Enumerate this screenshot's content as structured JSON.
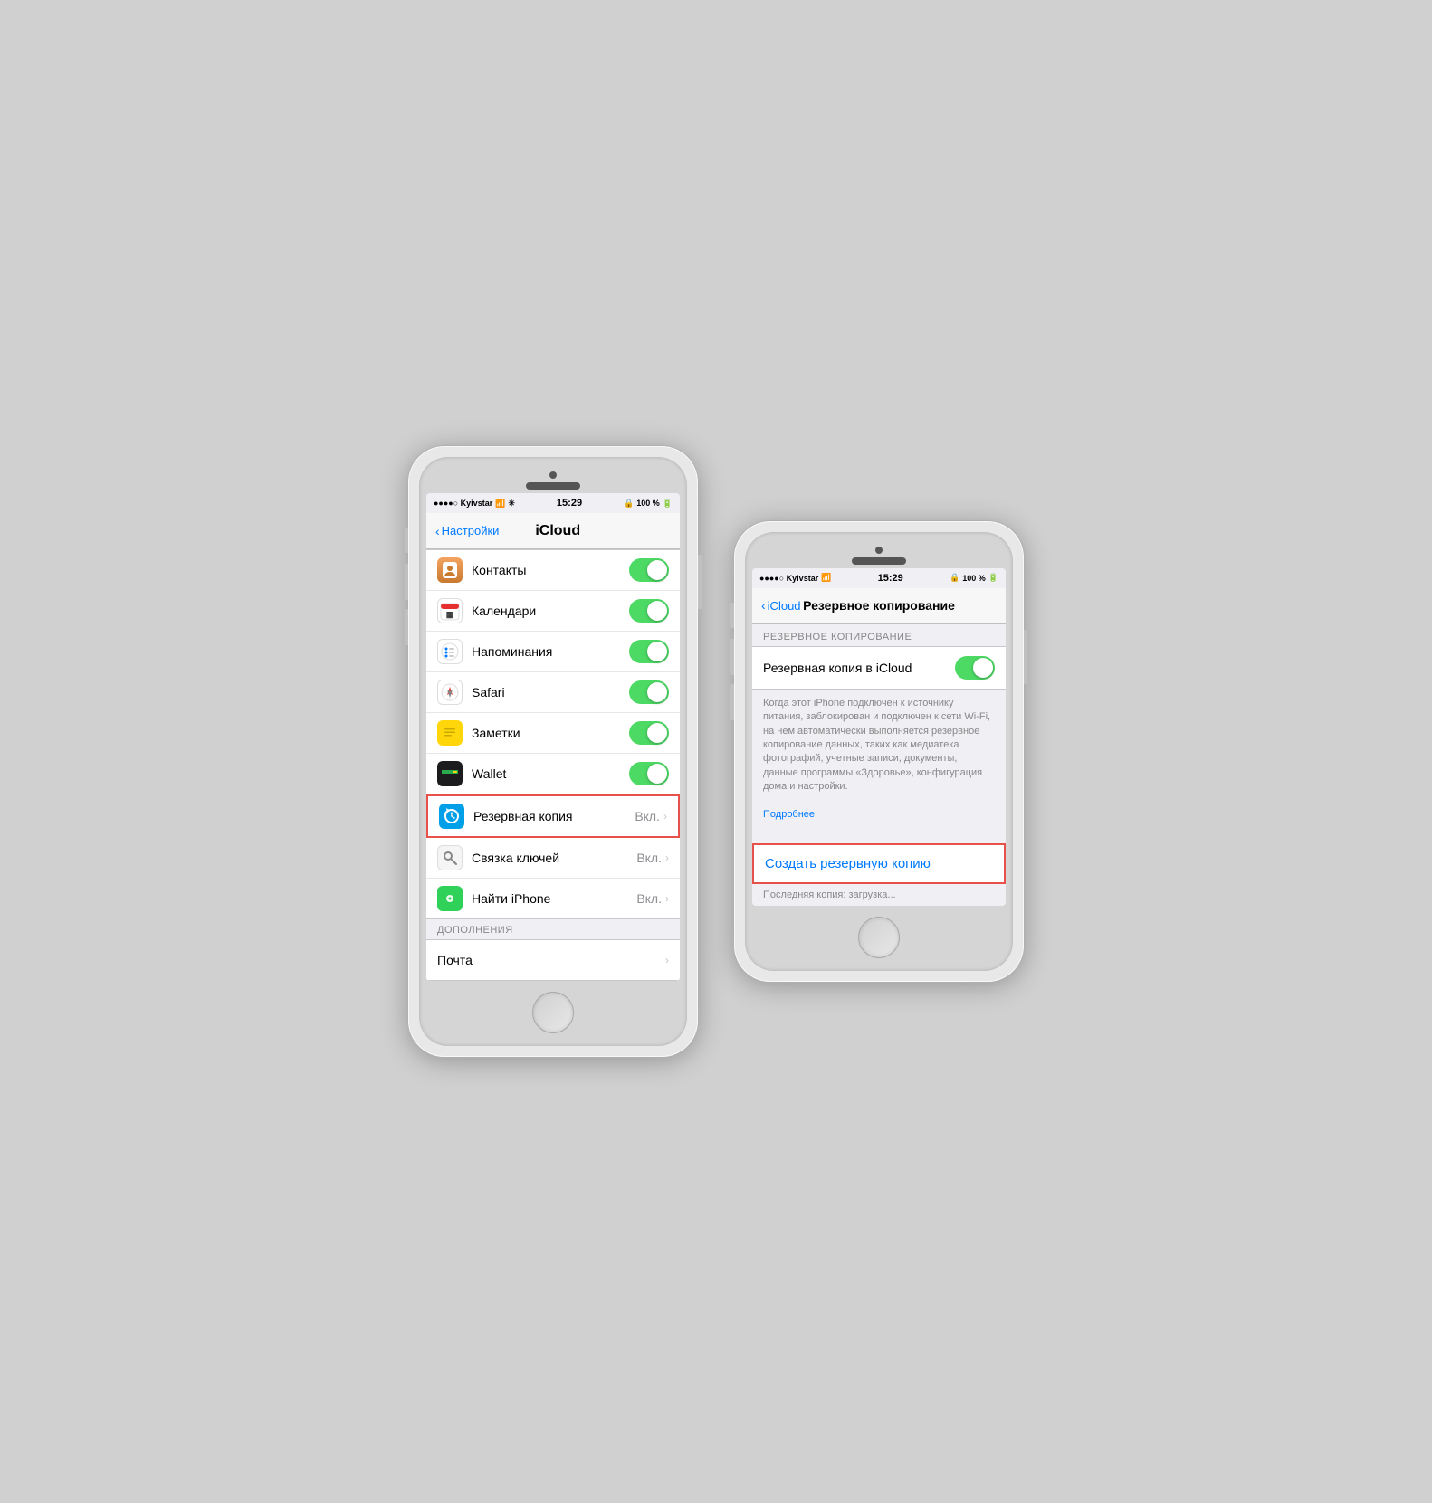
{
  "phone1": {
    "status": {
      "carrier": "●●●●○ Kyivstar",
      "wifi": "WiFi",
      "time": "15:29",
      "battery_icon": "🔒",
      "battery": "100 %"
    },
    "nav": {
      "back_label": "Настройки",
      "title": "iCloud"
    },
    "items": [
      {
        "id": "contacts",
        "icon_type": "contacts",
        "label": "Контакты",
        "has_toggle": true
      },
      {
        "id": "calendar",
        "icon_type": "calendar",
        "label": "Календари",
        "has_toggle": true
      },
      {
        "id": "reminders",
        "icon_type": "reminders",
        "label": "Напоминания",
        "has_toggle": true
      },
      {
        "id": "safari",
        "icon_type": "safari",
        "label": "Safari",
        "has_toggle": true
      },
      {
        "id": "notes",
        "icon_type": "notes",
        "label": "Заметки",
        "has_toggle": true
      },
      {
        "id": "wallet",
        "icon_type": "wallet",
        "label": "Wallet",
        "has_toggle": true
      },
      {
        "id": "backup",
        "icon_type": "backup",
        "label": "Резервная копия",
        "value": "Вкл.",
        "has_chevron": true,
        "highlighted": true
      },
      {
        "id": "keychain",
        "icon_type": "keychain",
        "label": "Связка ключей",
        "value": "Вкл.",
        "has_chevron": true
      },
      {
        "id": "findphone",
        "icon_type": "findphone",
        "label": "Найти iPhone",
        "value": "Вкл.",
        "has_chevron": true
      }
    ],
    "section_add": {
      "header": "ДОПОЛНЕНИЯ",
      "items": [
        {
          "id": "mail",
          "label": "Почта",
          "has_chevron": true
        }
      ]
    }
  },
  "phone2": {
    "status": {
      "carrier": "●●●●○ Kyivstar",
      "wifi": "WiFi",
      "time": "15:29",
      "battery_icon": "🔒",
      "battery": "100 %"
    },
    "nav": {
      "back_label": "iCloud",
      "title": "Резервное копирование"
    },
    "backup": {
      "section_header": "РЕЗЕРВНОЕ КОПИРОВАНИЕ",
      "toggle_label": "Резервная копия в iCloud",
      "description": "Когда этот iPhone подключен к источнику питания, заблокирован и подключен к сети Wi-Fi, на нем автоматически выполняется резервное копирование данных, таких как медиатека фотографий, учетные записи, документы, данные программы «Здоровье», конфигурация дома и настройки.",
      "link": "Подробнее",
      "action_label": "Создать резервную копию",
      "last_backup": "Последняя копия: загрузка..."
    }
  }
}
